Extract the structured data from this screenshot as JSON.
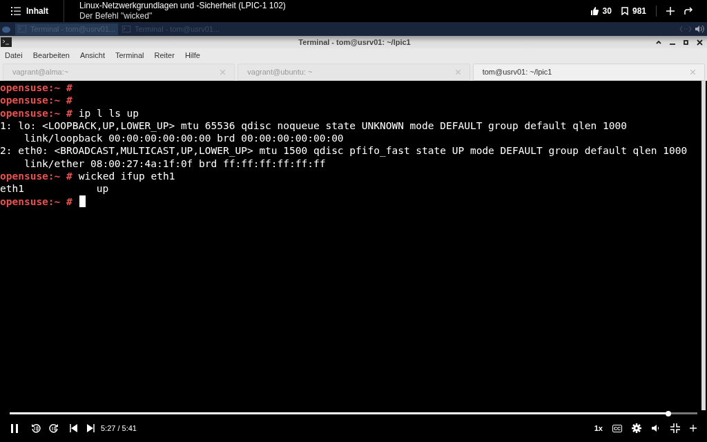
{
  "player_header": {
    "contents_label": "Inhalt",
    "course_title": "Linux-Netzwerkgrundlagen und -Sicherheit (LPIC-1 102)",
    "video_title": "Der Befehl \"wicked\"",
    "likes": "30",
    "saves": "981"
  },
  "taskbar": {
    "items": [
      {
        "label": "Terminal - tom@usrv01...",
        "selected": true
      },
      {
        "label": "Terminal - tom@usrv01...",
        "selected": false
      }
    ]
  },
  "window": {
    "title": "Terminal - tom@usrv01: ~/lpic1"
  },
  "menu": [
    "Datei",
    "Bearbeiten",
    "Ansicht",
    "Terminal",
    "Reiter",
    "Hilfe"
  ],
  "tabs": [
    {
      "label": "vagrant@alma:~",
      "selected": false
    },
    {
      "label": "vagrant@ubuntu: ~",
      "selected": false
    },
    {
      "label": "tom@usrv01: ~/lpic1",
      "selected": true
    }
  ],
  "terminal": [
    {
      "kind": "prompt",
      "prompt": "opensuse:~ #"
    },
    {
      "kind": "prompt",
      "prompt": "opensuse:~ #"
    },
    {
      "kind": "prompt",
      "prompt": "opensuse:~ #",
      "command": "ip l ls up"
    },
    {
      "kind": "output",
      "text": "1: lo: <LOOPBACK,UP,LOWER_UP> mtu 65536 qdisc noqueue state UNKNOWN mode DEFAULT group default qlen 1000"
    },
    {
      "kind": "output",
      "text": "    link/loopback 00:00:00:00:00:00 brd 00:00:00:00:00:00"
    },
    {
      "kind": "output",
      "text": "2: eth0: <BROADCAST,MULTICAST,UP,LOWER_UP> mtu 1500 qdisc pfifo_fast state UP mode DEFAULT group default qlen 1000"
    },
    {
      "kind": "output",
      "text": "    link/ether 08:00:27:4a:1f:0f brd ff:ff:ff:ff:ff:ff"
    },
    {
      "kind": "prompt",
      "prompt": "opensuse:~ #",
      "command": "wicked ifup eth1"
    },
    {
      "kind": "output",
      "text": "eth1            up"
    },
    {
      "kind": "prompt",
      "prompt": "opensuse:~ #",
      "cursor": true
    }
  ],
  "player": {
    "level": 0.958,
    "time": "5:27 / 5:41",
    "playing": true,
    "speed": "1x",
    "captions": "CC"
  }
}
